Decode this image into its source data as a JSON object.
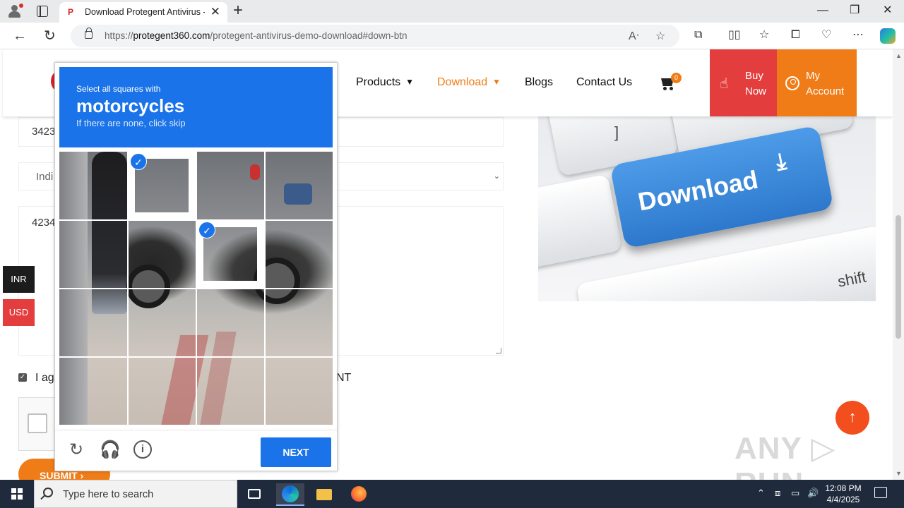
{
  "browser": {
    "tab_title": "Download Protegent Antivirus - P",
    "tab_favicon": "P",
    "url_domain": "protegent360.com",
    "url_prefix": "https://",
    "url_path": "/protegent-antivirus-demo-download#down-btn",
    "window_controls": [
      "—",
      "❐",
      "✕"
    ]
  },
  "header": {
    "nav": [
      {
        "label": "Products",
        "has_dropdown": true
      },
      {
        "label": "Download",
        "has_dropdown": true,
        "active": true
      },
      {
        "label": "Blogs"
      },
      {
        "label": "Contact Us"
      }
    ],
    "cart_count": "0",
    "buy_now": "Buy Now",
    "my_account": "My Account",
    "accent_color": "#f07c18",
    "buy_color": "#e43d3d"
  },
  "form": {
    "field1_value": "3423",
    "select_value": "Indi",
    "textarea_value": "4234",
    "agree_prefix": "I ag",
    "agree_suffix": "NT",
    "submit_label": "SUBMIT ›"
  },
  "currency": {
    "inr": "INR",
    "usd": "USD"
  },
  "image": {
    "key_label": "Download",
    "key_top": "]",
    "shift_label": "shift"
  },
  "captcha": {
    "line1": "Select all squares with",
    "line2": "motorcycles",
    "line3": "If there are none, click skip",
    "next_label": "NEXT",
    "selected_cells": [
      1,
      6
    ]
  },
  "watermark": "ANY ▷ RUN",
  "taskbar": {
    "search_placeholder": "Type here to search",
    "time": "12:08 PM",
    "date": "4/4/2025"
  }
}
